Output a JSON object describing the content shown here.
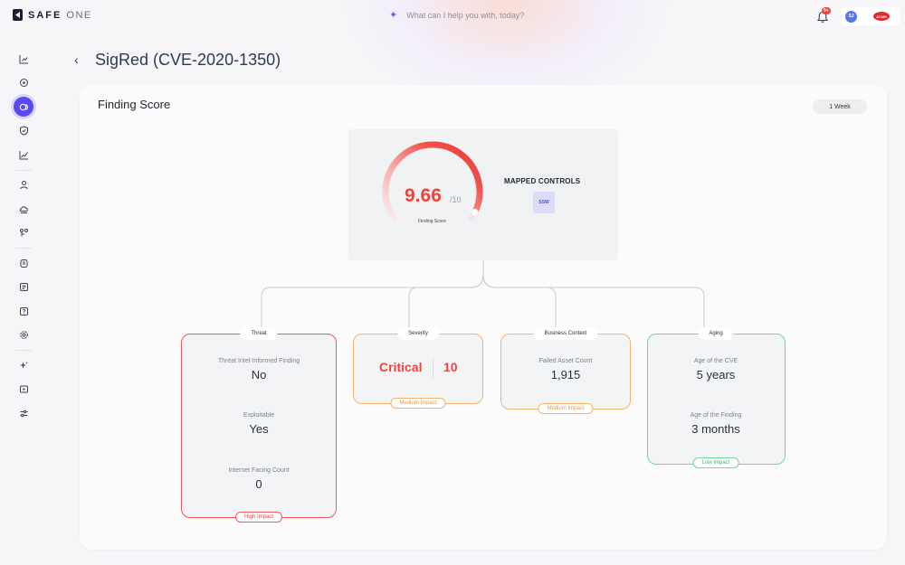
{
  "app": {
    "logo_primary": "SAFE",
    "logo_secondary": "ONE"
  },
  "search": {
    "placeholder": "What can I help you with, today?"
  },
  "notifications": {
    "badge": "9+"
  },
  "user": {
    "initials": "SJ",
    "brand": "ACME"
  },
  "page": {
    "title": "SigRed (CVE-2020-1350)"
  },
  "card": {
    "title": "Finding Score",
    "range": "1 Week"
  },
  "score": {
    "value": "9.66",
    "max": "/10",
    "label": "Finding Score",
    "fraction": 0.966
  },
  "mapped_controls": {
    "title": "MAPPED CONTROLS",
    "controls": [
      "SSW"
    ]
  },
  "factors": {
    "threat": {
      "tag": "Threat",
      "items": [
        {
          "label": "Threat Intel-Informed Finding",
          "value": "No"
        },
        {
          "label": "Exploitable",
          "value": "Yes"
        },
        {
          "label": "Internet Facing Count",
          "value": "0"
        }
      ],
      "impact": "High Impact"
    },
    "severity": {
      "tag": "Severity",
      "level": "Critical",
      "value": "10",
      "impact": "Medium Impact"
    },
    "business": {
      "tag": "Business Context",
      "items": [
        {
          "label": "Failed Asset Count",
          "value": "1,915"
        }
      ],
      "impact": "Medium Impact"
    },
    "aging": {
      "tag": "Aging",
      "items": [
        {
          "label": "Age of the CVE",
          "value": "5 years"
        },
        {
          "label": "Age of the Finding",
          "value": "3 months"
        }
      ],
      "impact": "Low Impact"
    }
  },
  "colors": {
    "accent": "#5b48f5",
    "danger": "#f0443a",
    "warning": "#f5b26b",
    "success": "#6fd89a"
  },
  "sidebar": {
    "items": [
      {
        "icon": "chart-bar-icon"
      },
      {
        "icon": "target-icon"
      },
      {
        "icon": "findings-icon",
        "active": true
      },
      {
        "icon": "shield-icon"
      },
      {
        "icon": "trend-line-icon"
      },
      {
        "icon": "user-icon"
      },
      {
        "icon": "cloud-icon"
      },
      {
        "icon": "integration-icon"
      },
      {
        "icon": "database-icon"
      },
      {
        "icon": "list-icon"
      },
      {
        "icon": "help-icon"
      },
      {
        "icon": "settings-icon"
      },
      {
        "icon": "sparkle-icon"
      },
      {
        "icon": "media-icon"
      },
      {
        "icon": "sliders-icon"
      }
    ]
  }
}
